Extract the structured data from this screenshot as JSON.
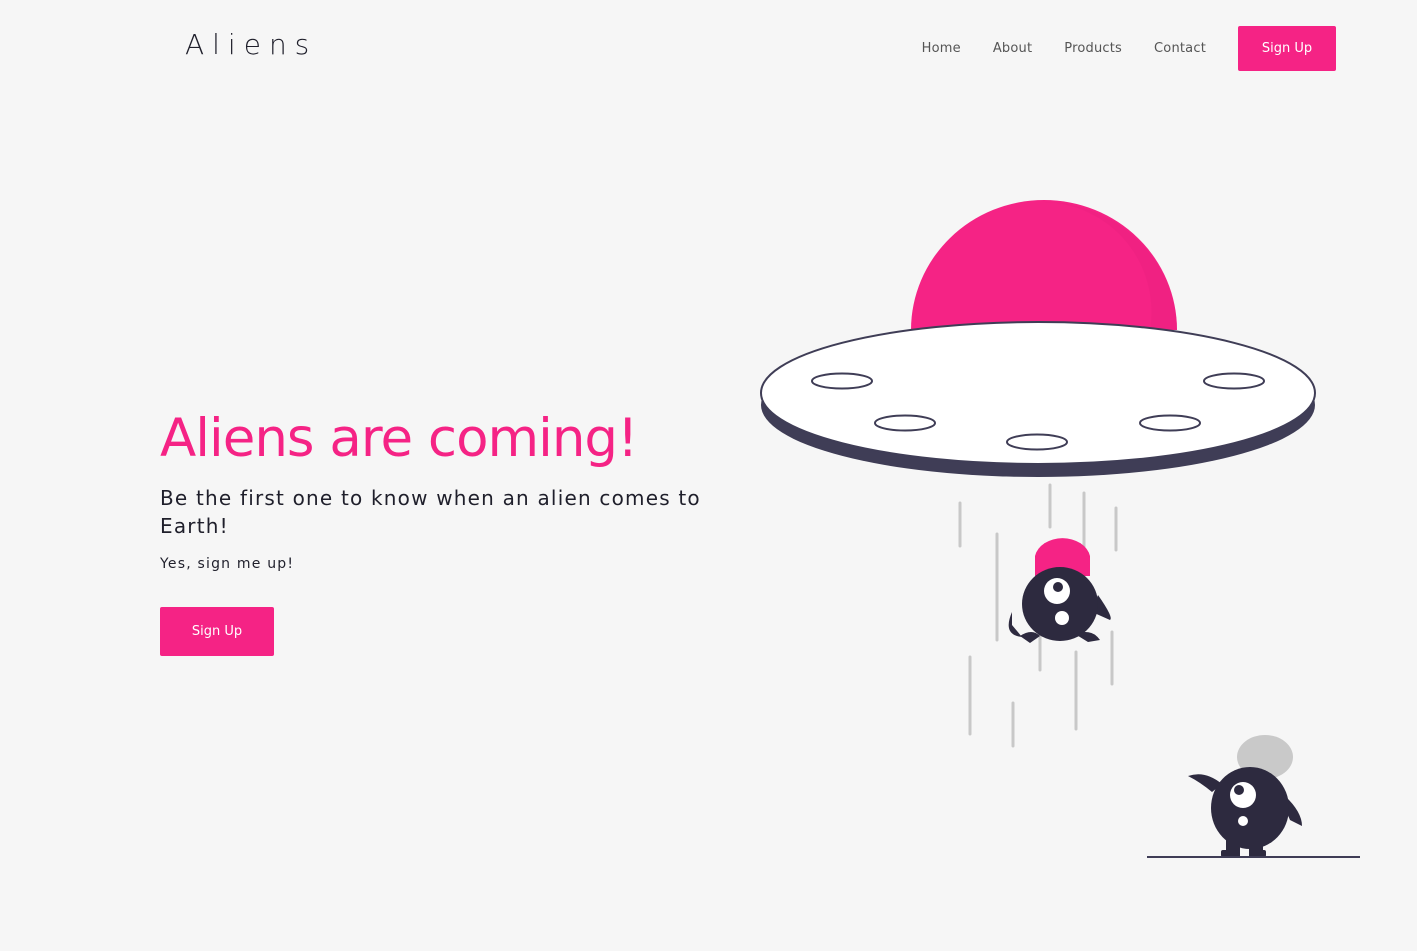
{
  "header": {
    "logo": "Aliens",
    "nav": [
      "Home",
      "About",
      "Products",
      "Contact"
    ],
    "signup_label": "Sign Up"
  },
  "hero": {
    "title": "Aliens are coming!",
    "subtitle": "Be the first one to know when an alien comes to Earth!",
    "note": "Yes, sign me up!",
    "button_label": "Sign Up"
  },
  "colors": {
    "accent": "#f52385",
    "dark": "#2d2a3f",
    "background": "#f6f6f6"
  },
  "illustration": {
    "name": "ufo-abducting-alien"
  }
}
